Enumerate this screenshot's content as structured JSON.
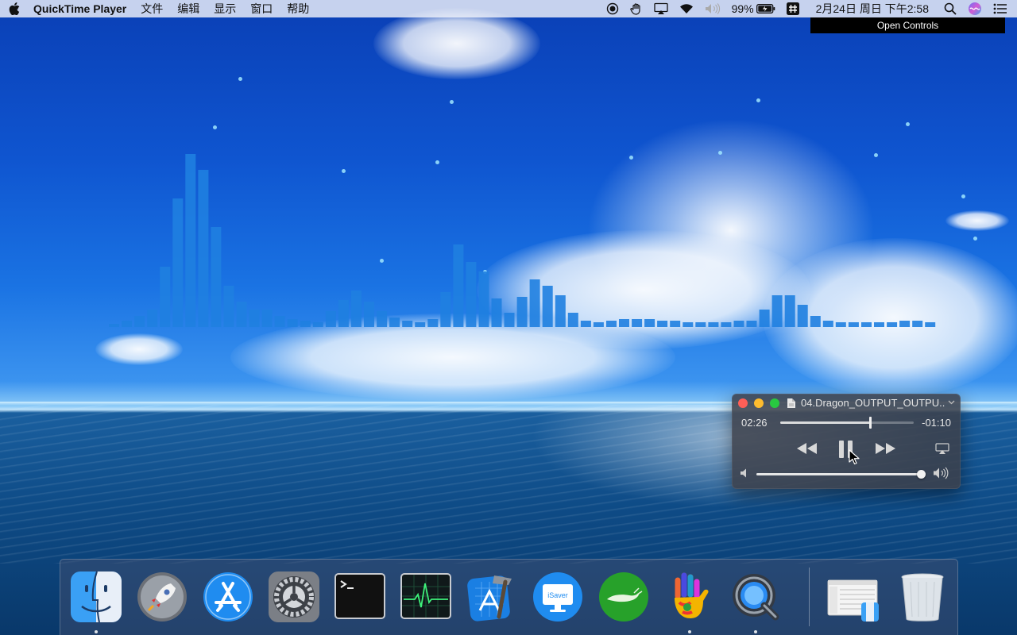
{
  "menubar": {
    "app_name": "QuickTime Player",
    "menus": [
      "文件",
      "编辑",
      "显示",
      "窗口",
      "帮助"
    ],
    "battery": "99%",
    "datetime": "2月24日 周日 下午2:58",
    "status_icons": [
      "record-icon",
      "hand-icon",
      "airplay-icon",
      "wifi-icon",
      "volume-mute-icon",
      "battery-icon",
      "hashtag-icon",
      "spotlight-icon",
      "siri-icon",
      "notification-center-icon"
    ]
  },
  "tooltip": {
    "text": "Open Controls"
  },
  "player": {
    "title": "04.Dragon_OUTPUT_OUTPU...",
    "elapsed": "02:26",
    "remaining": "-01:10",
    "progress": 0.67,
    "volume": 0.97,
    "state": "playing"
  },
  "dock": {
    "apps": [
      {
        "name": "Finder",
        "icon": "finder-icon",
        "running": true
      },
      {
        "name": "Launchpad",
        "icon": "launchpad-icon",
        "running": false
      },
      {
        "name": "App Store",
        "icon": "app-store-icon",
        "running": false
      },
      {
        "name": "System Preferences",
        "icon": "system-preferences-icon",
        "running": false
      },
      {
        "name": "Terminal",
        "icon": "terminal-icon",
        "running": false
      },
      {
        "name": "Activity Monitor",
        "icon": "activity-monitor-icon",
        "running": false
      },
      {
        "name": "Xcode",
        "icon": "xcode-icon",
        "running": false
      },
      {
        "name": "iSaver",
        "icon": "isaver-icon",
        "running": false,
        "label": "iSaver"
      },
      {
        "name": "Whale",
        "icon": "whale-icon",
        "running": false
      },
      {
        "name": "Painted Hand",
        "icon": "painted-hand-icon",
        "running": true
      },
      {
        "name": "QuickTime Player",
        "icon": "quicktime-icon",
        "running": true
      }
    ],
    "others": [
      {
        "name": "Finder Window",
        "icon": "finder-window-thumbnail-icon"
      },
      {
        "name": "Trash",
        "icon": "trash-icon"
      }
    ]
  },
  "colors": {
    "visualizer_bar": "#1f7fe0",
    "close": "#ff5f57",
    "minimize": "#febc2e",
    "zoom": "#28c840"
  }
}
